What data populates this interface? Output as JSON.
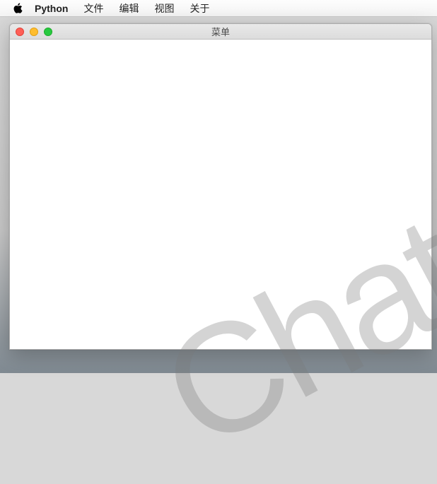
{
  "menubar": {
    "app_name": "Python",
    "items": [
      "文件",
      "编辑",
      "视图",
      "关于"
    ]
  },
  "window": {
    "title": "菜单"
  },
  "watermark": {
    "text": "Chat"
  }
}
